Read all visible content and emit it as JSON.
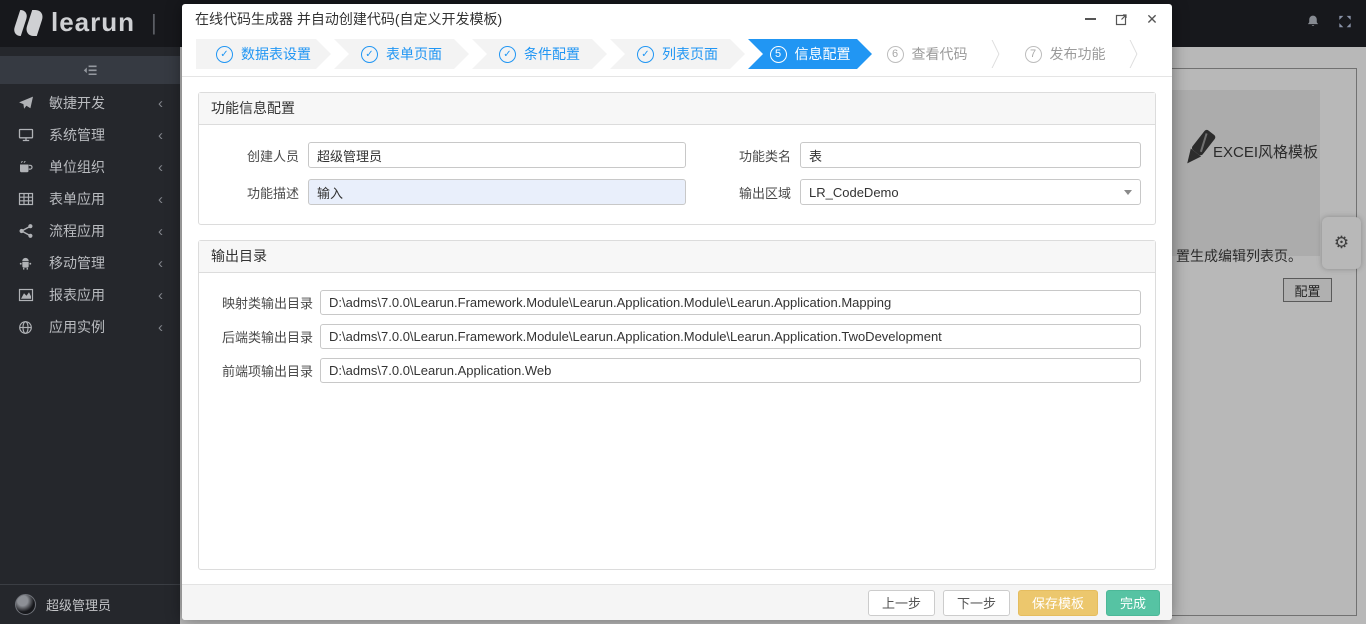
{
  "icons": {
    "chevron_left": "‹",
    "close": "✕",
    "gear": "⚙",
    "bell": "bell-icon",
    "fullscreen": "fullscreen-icon",
    "minimize": "minimize-icon",
    "maximize": "maximize-icon"
  },
  "header": {
    "brand": "learun",
    "separator": "|"
  },
  "sidebar": {
    "items": [
      {
        "label": "敏捷开发",
        "icon": "paper-plane-icon"
      },
      {
        "label": "系统管理",
        "icon": "desktop-icon"
      },
      {
        "label": "单位组织",
        "icon": "mug-icon"
      },
      {
        "label": "表单应用",
        "icon": "table-icon"
      },
      {
        "label": "流程应用",
        "icon": "share-icon"
      },
      {
        "label": "移动管理",
        "icon": "android-icon"
      },
      {
        "label": "报表应用",
        "icon": "area-chart-icon"
      },
      {
        "label": "应用实例",
        "icon": "globe-icon"
      }
    ],
    "user": {
      "name": "超级管理员"
    }
  },
  "background": {
    "template_card_title": "EXCEI风格模板",
    "partial_caption": "置生成编辑列表页。",
    "config_button": "配置"
  },
  "modal": {
    "title": "在线代码生成器 并自动创建代码(自定义开发模板)",
    "steps": [
      {
        "marker": "✓",
        "label": "数据表设置",
        "state": "done"
      },
      {
        "marker": "✓",
        "label": "表单页面",
        "state": "done"
      },
      {
        "marker": "✓",
        "label": "条件配置",
        "state": "done"
      },
      {
        "marker": "✓",
        "label": "列表页面",
        "state": "done"
      },
      {
        "marker": "5",
        "label": "信息配置",
        "state": "active"
      },
      {
        "marker": "6",
        "label": "查看代码",
        "state": "pending"
      },
      {
        "marker": "7",
        "label": "发布功能",
        "state": "pending"
      }
    ],
    "info_section": {
      "title": "功能信息配置",
      "creator_label": "创建人员",
      "creator_value": "超级管理员",
      "desc_label": "功能描述",
      "desc_value": "输入",
      "class_label": "功能类名",
      "class_value": "表",
      "area_label": "输出区域",
      "area_value": "LR_CodeDemo"
    },
    "output_section": {
      "title": "输出目录",
      "rows": [
        {
          "label": "映射类输出目录",
          "value": "D:\\adms\\7.0.0\\Learun.Framework.Module\\Learun.Application.Module\\Learun.Application.Mapping"
        },
        {
          "label": "后端类输出目录",
          "value": "D:\\adms\\7.0.0\\Learun.Framework.Module\\Learun.Application.Module\\Learun.Application.TwoDevelopment"
        },
        {
          "label": "前端项输出目录",
          "value": "D:\\adms\\7.0.0\\Learun.Application.Web"
        }
      ]
    },
    "footer_buttons": [
      {
        "label": "上一步",
        "style": "default"
      },
      {
        "label": "下一步",
        "style": "default"
      },
      {
        "label": "保存模板",
        "style": "warning"
      },
      {
        "label": "完成",
        "style": "success"
      }
    ]
  },
  "colors": {
    "accent": "#2196f3",
    "warning": "#ecc76d",
    "success": "#56c3a3",
    "header_bg": "#17181c",
    "sidebar_bg": "#25272c"
  }
}
